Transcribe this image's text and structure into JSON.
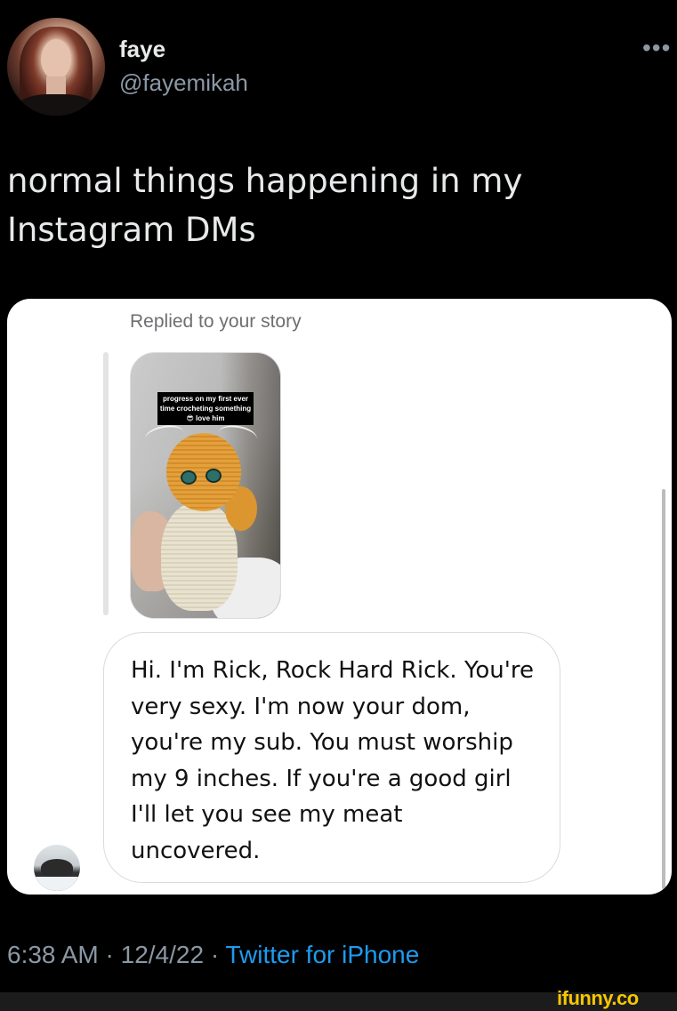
{
  "tweet": {
    "author": {
      "display_name": "faye",
      "handle": "@fayemikah",
      "avatar_icon": "profile-photo"
    },
    "more_menu_label": "•••",
    "text": "normal things happening in my Instagram DMs",
    "timestamp_time": "6:38 AM",
    "timestamp_date": "12/4/22",
    "separator": "·",
    "source": "Twitter for iPhone"
  },
  "screenshot": {
    "replied_label": "Replied to your story",
    "story": {
      "caption": "progress on my first ever time crocheting something 😎 love him"
    },
    "message": {
      "text": "Hi. I'm Rick, Rock Hard Rick. You're very sexy. I'm now your dom, you're my sub. You must worship my 9 inches. If you're a good girl I'll let you see my meat uncovered."
    }
  },
  "watermark": "ifunny.co",
  "colors": {
    "background": "#000000",
    "text_primary": "#e7e9ea",
    "text_secondary": "#8b98a5",
    "link": "#1d9bf0",
    "watermark": "#f6c700"
  }
}
